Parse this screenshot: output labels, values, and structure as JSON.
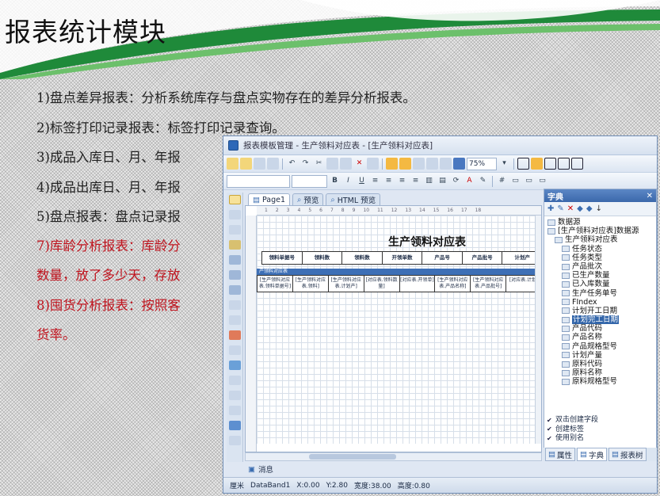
{
  "slide": {
    "title": "报表统计模块",
    "bullets": [
      {
        "text": "1)盘点差异报表：分析系统库存与盘点实物存在的差异分析报表。",
        "red": false
      },
      {
        "text": "2)标签打印记录报表：标签打印记录查询。",
        "red": false
      },
      {
        "text": "3)成品入库日、月、年报",
        "red": false
      },
      {
        "text": "4)成品出库日、月、年报",
        "red": false
      },
      {
        "text": "5)盘点报表：盘点记录报",
        "red": false
      },
      {
        "text": "7)库龄分析报表：库龄分",
        "red": true
      },
      {
        "text": "数量，放了多少天，存放",
        "red": true
      },
      {
        "text": "8)囤货分析报表：按照客",
        "red": true
      },
      {
        "text": "货率。",
        "red": true
      }
    ]
  },
  "window": {
    "title": "报表模板管理 - 生产领料对应表 - [生产领料对应表]",
    "zoom": "75%",
    "tabs": [
      "Page1",
      "预览",
      "HTML 预览"
    ],
    "ruler": [
      "1",
      "2",
      "3",
      "4",
      "5",
      "6",
      "7",
      "8",
      "9",
      "10",
      "11",
      "12",
      "13",
      "14",
      "15",
      "16",
      "17",
      "18"
    ],
    "report": {
      "title": "生产领料对应表",
      "headers": [
        "领料单据号",
        "领料数",
        "领料数",
        "开领单数",
        "产品号",
        "产品批号",
        "计划产"
      ],
      "band_label": "产领料对应表",
      "cells": [
        "[生产领料对应表.领料单据号]",
        "[生产领料对应表.领料]",
        "[生产领料对应表.计划产]",
        "[对应表.领料数量]",
        "[对应表.开领单]",
        "[生产领料对应表.产品名称]",
        "[生产领料对应表.产品批号]",
        "[对应表.计划]"
      ]
    },
    "message_tab": "消息",
    "status": {
      "unit": "厘米",
      "band": "DataBand1",
      "x": "X:0.00",
      "y": "Y:2.80",
      "width": "宽度:38.00",
      "height": "高度:0.80"
    },
    "dict": {
      "title": "字典",
      "tree": [
        {
          "label": "数据源",
          "level": 0,
          "sel": false
        },
        {
          "label": "[生产领料对应表]数据源",
          "level": 0,
          "sel": false
        },
        {
          "label": "生产领料对应表",
          "level": 1,
          "sel": false
        },
        {
          "label": "任务状态",
          "level": 2,
          "sel": false
        },
        {
          "label": "任务类型",
          "level": 2,
          "sel": false
        },
        {
          "label": "产品批次",
          "level": 2,
          "sel": false
        },
        {
          "label": "已生产数量",
          "level": 2,
          "sel": false
        },
        {
          "label": "已入库数量",
          "level": 2,
          "sel": false
        },
        {
          "label": "生产任务单号",
          "level": 2,
          "sel": false
        },
        {
          "label": "FIndex",
          "level": 2,
          "sel": false
        },
        {
          "label": "计划开工日期",
          "level": 2,
          "sel": false
        },
        {
          "label": "计划完工日期",
          "level": 2,
          "sel": true
        },
        {
          "label": "产品代码",
          "level": 2,
          "sel": false
        },
        {
          "label": "产品名称",
          "level": 2,
          "sel": false
        },
        {
          "label": "产品规格型号",
          "level": 2,
          "sel": false
        },
        {
          "label": "计划产量",
          "level": 2,
          "sel": false
        },
        {
          "label": "原料代码",
          "level": 2,
          "sel": false
        },
        {
          "label": "原料名称",
          "level": 2,
          "sel": false
        },
        {
          "label": "原料规格型号",
          "level": 2,
          "sel": false
        }
      ],
      "options": [
        "双击创建字段",
        "创建标签",
        "使用别名"
      ],
      "panel_tabs": [
        "属性",
        "字典",
        "报表树"
      ]
    }
  }
}
